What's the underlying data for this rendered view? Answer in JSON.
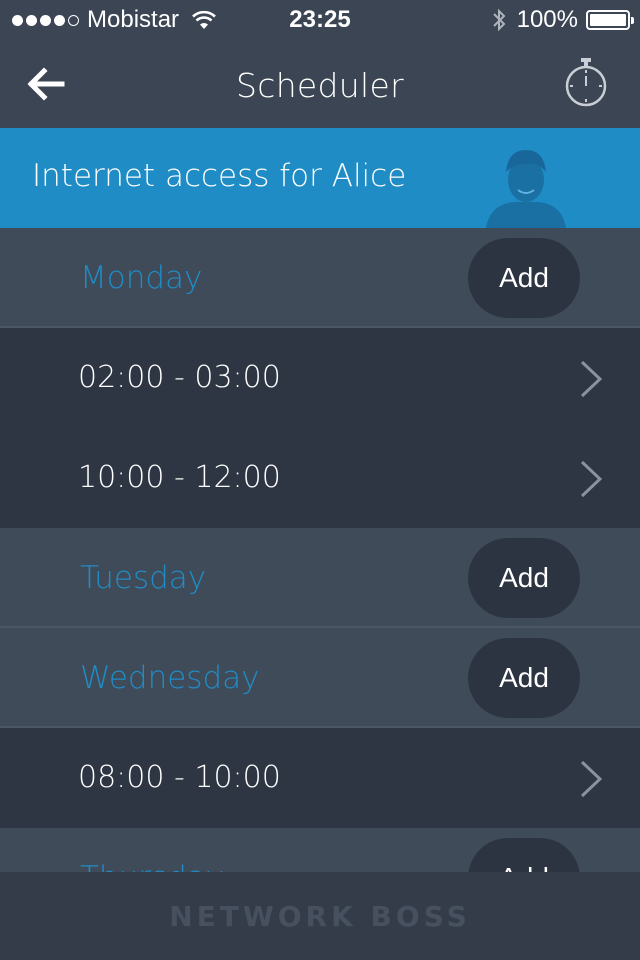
{
  "status_bar": {
    "carrier": "Mobistar",
    "time": "23:25",
    "battery": "100%",
    "signal_bars_filled": 4,
    "signal_bars_total": 5
  },
  "navbar": {
    "title": "Scheduler",
    "back_icon": "back-arrow-icon",
    "timer_icon": "stopwatch-icon"
  },
  "banner": {
    "text": "Internet access for Alice",
    "color": "#1f8cc6"
  },
  "schedule": [
    {
      "day": "Monday",
      "add_label": "Add",
      "slots": [
        "02:00 - 03:00",
        "10:00 - 12:00"
      ]
    },
    {
      "day": "Tuesday",
      "add_label": "Add",
      "slots": []
    },
    {
      "day": "Wednesday",
      "add_label": "Add",
      "slots": [
        "08:00 - 10:00"
      ]
    },
    {
      "day": "Thursday",
      "add_label": "Add",
      "slots": []
    }
  ],
  "footer": {
    "brand": "NETWORK BOSS"
  },
  "colors": {
    "accent": "#1f8cc6",
    "day_row": "#404b59",
    "slot_row": "#2e3543",
    "add_button": "#2d3441"
  }
}
